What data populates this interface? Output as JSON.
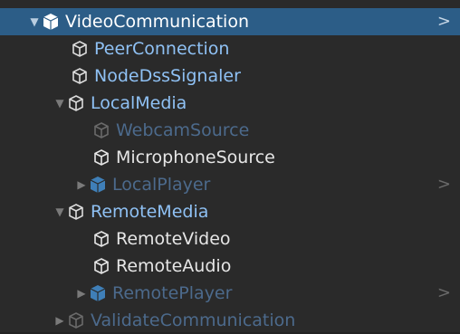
{
  "hierarchy": {
    "items": [
      {
        "label": "VideoCommunication",
        "expanded": true,
        "icon": "prefab-icon",
        "state": "selected"
      },
      {
        "label": "PeerConnection",
        "icon": "gameobject-icon",
        "state": "active"
      },
      {
        "label": "NodeDssSignaler",
        "icon": "gameobject-icon",
        "state": "active"
      },
      {
        "label": "LocalMedia",
        "expanded": true,
        "icon": "gameobject-icon",
        "state": "active"
      },
      {
        "label": "WebcamSource",
        "icon": "gameobject-icon",
        "state": "inactive"
      },
      {
        "label": "MicrophoneSource",
        "icon": "gameobject-icon",
        "state": "active"
      },
      {
        "label": "LocalPlayer",
        "expanded": false,
        "icon": "prefab-icon",
        "state": "inactive"
      },
      {
        "label": "RemoteMedia",
        "expanded": true,
        "icon": "gameobject-icon",
        "state": "active"
      },
      {
        "label": "RemoteVideo",
        "icon": "gameobject-icon",
        "state": "active"
      },
      {
        "label": "RemoteAudio",
        "icon": "gameobject-icon",
        "state": "active"
      },
      {
        "label": "RemotePlayer",
        "expanded": false,
        "icon": "prefab-icon",
        "state": "inactive"
      },
      {
        "label": "ValidateCommunication",
        "expanded": false,
        "icon": "gameobject-icon",
        "state": "inactive"
      }
    ]
  },
  "colors": {
    "selection": "#2c5d87",
    "active_text": "#8fc1f4",
    "inactive_text": "#4c6a8c",
    "background": "#2a2a2a"
  }
}
